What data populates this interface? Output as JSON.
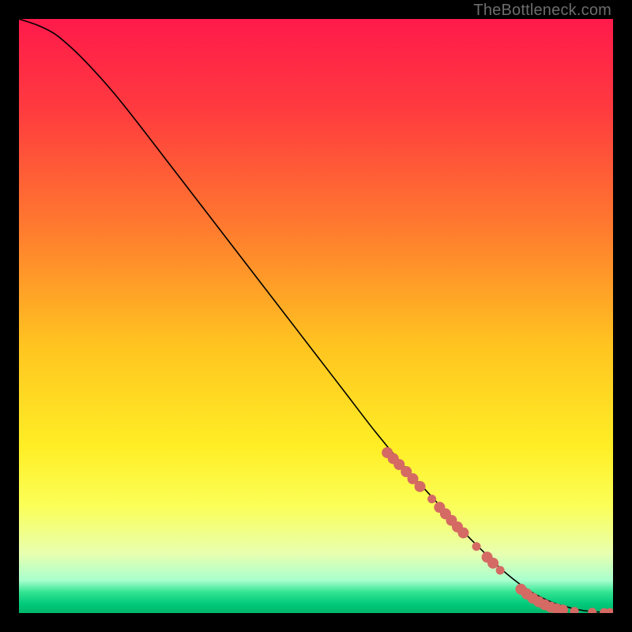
{
  "watermark": "TheBottleneck.com",
  "chart_data": {
    "type": "line",
    "title": "",
    "xlabel": "",
    "ylabel": "",
    "xlim": [
      0,
      100
    ],
    "ylim": [
      0,
      100
    ],
    "grid": false,
    "legend": false,
    "gradient_stops": [
      {
        "offset": 0.0,
        "color": "#ff1a4b"
      },
      {
        "offset": 0.15,
        "color": "#ff3a3f"
      },
      {
        "offset": 0.35,
        "color": "#ff7a2f"
      },
      {
        "offset": 0.55,
        "color": "#ffc420"
      },
      {
        "offset": 0.72,
        "color": "#ffee25"
      },
      {
        "offset": 0.82,
        "color": "#fbff58"
      },
      {
        "offset": 0.9,
        "color": "#e8ffb0"
      },
      {
        "offset": 0.945,
        "color": "#a8ffce"
      },
      {
        "offset": 0.965,
        "color": "#32e492"
      },
      {
        "offset": 0.985,
        "color": "#00c97a"
      },
      {
        "offset": 1.0,
        "color": "#00b76a"
      }
    ],
    "series": [
      {
        "name": "curve",
        "stroke": "#000000",
        "stroke_width": 1.6,
        "x": [
          0,
          3,
          6,
          9,
          12,
          16,
          20,
          25,
          30,
          35,
          40,
          45,
          50,
          55,
          60,
          65,
          70,
          75,
          78,
          80,
          82,
          84,
          86,
          88,
          90,
          92,
          94,
          96,
          98,
          100
        ],
        "y": [
          100,
          99,
          97.5,
          95,
          92,
          87.5,
          82.5,
          76,
          69.5,
          63,
          56.5,
          50,
          43.5,
          37,
          30.5,
          24.5,
          19,
          13.5,
          10.5,
          8.5,
          6.7,
          5.1,
          3.7,
          2.6,
          1.7,
          1.1,
          0.6,
          0.3,
          0.15,
          0.1
        ]
      }
    ],
    "markers": {
      "color": "#d46a63",
      "radius_small": 5.5,
      "radius_large": 7,
      "points": [
        {
          "x": 62.0,
          "y": 27.0,
          "r": "large"
        },
        {
          "x": 63.0,
          "y": 26.0,
          "r": "large"
        },
        {
          "x": 64.0,
          "y": 25.0,
          "r": "large"
        },
        {
          "x": 65.2,
          "y": 23.8,
          "r": "large"
        },
        {
          "x": 66.3,
          "y": 22.6,
          "r": "large"
        },
        {
          "x": 67.5,
          "y": 21.3,
          "r": "large"
        },
        {
          "x": 69.5,
          "y": 19.2,
          "r": "small"
        },
        {
          "x": 70.8,
          "y": 17.8,
          "r": "large"
        },
        {
          "x": 71.8,
          "y": 16.7,
          "r": "large"
        },
        {
          "x": 72.8,
          "y": 15.6,
          "r": "large"
        },
        {
          "x": 73.8,
          "y": 14.5,
          "r": "large"
        },
        {
          "x": 74.8,
          "y": 13.5,
          "r": "large"
        },
        {
          "x": 77.0,
          "y": 11.2,
          "r": "small"
        },
        {
          "x": 78.8,
          "y": 9.4,
          "r": "large"
        },
        {
          "x": 79.8,
          "y": 8.4,
          "r": "large"
        },
        {
          "x": 81.0,
          "y": 7.2,
          "r": "small"
        },
        {
          "x": 84.5,
          "y": 4.0,
          "r": "large"
        },
        {
          "x": 85.5,
          "y": 3.2,
          "r": "large"
        },
        {
          "x": 86.5,
          "y": 2.5,
          "r": "large"
        },
        {
          "x": 87.5,
          "y": 1.9,
          "r": "large"
        },
        {
          "x": 88.5,
          "y": 1.4,
          "r": "large"
        },
        {
          "x": 89.5,
          "y": 1.0,
          "r": "large"
        },
        {
          "x": 90.5,
          "y": 0.7,
          "r": "large"
        },
        {
          "x": 91.5,
          "y": 0.5,
          "r": "large"
        },
        {
          "x": 93.5,
          "y": 0.3,
          "r": "small"
        },
        {
          "x": 96.5,
          "y": 0.15,
          "r": "small"
        },
        {
          "x": 98.5,
          "y": 0.1,
          "r": "small"
        },
        {
          "x": 99.5,
          "y": 0.1,
          "r": "small"
        }
      ]
    }
  }
}
